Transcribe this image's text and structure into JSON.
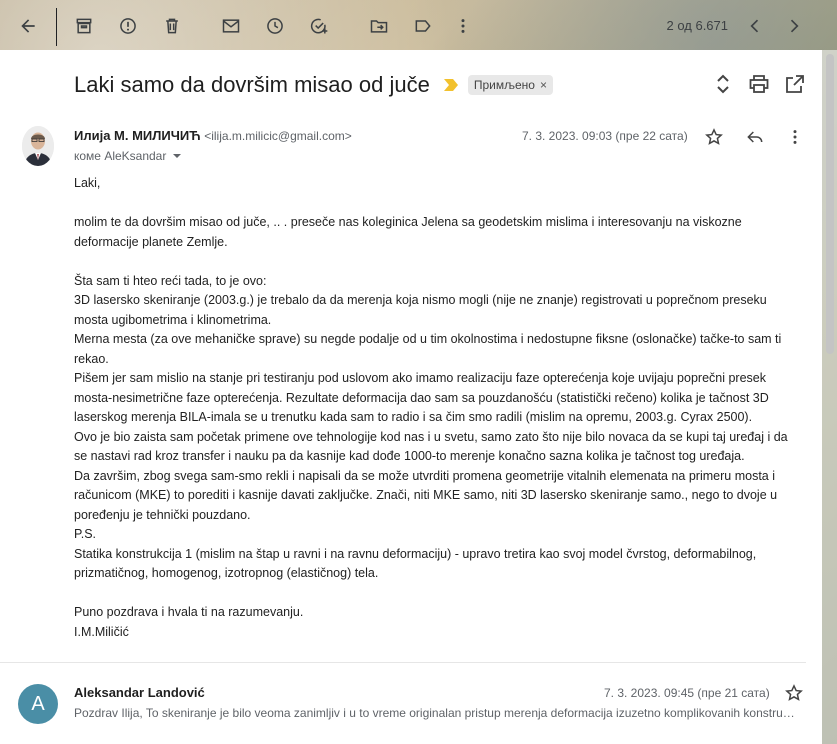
{
  "toolbar": {
    "back": "back-icon",
    "archive": "archive-icon",
    "report_spam": "report-spam-icon",
    "delete": "trash-icon",
    "mark_unread": "mail-icon",
    "snooze": "clock-icon",
    "add_task": "add-task-icon",
    "move_to": "move-to-folder-icon",
    "labels": "label-icon",
    "more": "more-vert-icon",
    "pager": "2 од 6.671"
  },
  "thread": {
    "subject": "Laki samo da dovršim misao od juče",
    "label": "Примљено",
    "label_close": "×"
  },
  "message1": {
    "sender_name": "Илија М. МИЛИЧИЋ",
    "sender_email": "<ilija.m.milicic@gmail.com>",
    "recipient": "коме AleKsandar",
    "date": "7. 3. 2023. 09:03 (пре 22 сата)",
    "body": [
      "Laki,",
      "",
      "molim te da dovršim misao od juče, .. . preseče nas koleginica Jelena sa geodetskim mislima i interesovanju na viskozne deformacije planete Zemlje.",
      "",
      "Šta sam ti hteo reći tada, to je ovo:",
      "3D lasersko skeniranje (2003.g.) je trebalo da da merenja koja nismo mogli (nije ne znanje) registrovati u poprečnom preseku mosta ugibometrima i klinometrima.",
      "Merna mesta (za ove mehaničke sprave) su negde podalje od u tim okolnostima i nedostupne fiksne (oslonačke) tačke-to sam ti rekao.",
      "Pišem jer sam mislio na stanje pri testiranju pod uslovom ako imamo realizaciju faze opterećenja koje uvijaju poprečni presek mosta-nesimetrične faze opterećenja. Rezultate deformacija dao sam sa pouzdanošću (statistički rečeno) kolika je tačnost 3D laserskog merenja BILA-imala se u trenutku kada sam to radio i sa čim smo radili (mislim na opremu, 2003.g. Cyrax 2500).",
      "Ovo je bio zaista sam početak primene ove tehnologije kod nas i u svetu, samo zato što nije bilo novaca da se kupi taj uređaj i da se nastavi rad kroz transfer i nauku pa da kasnije kad dođe 1000-to merenje konačno sazna kolika je tačnost tog uređaja.",
      "Da završim, zbog svega sam-smo rekli i napisali da se može utvrditi promena geometrije vitalnih elemenata na primeru mosta i računicom (MKE) to porediti i kasnije davati zaključke. Znači, niti MKE samo, niti 3D lasersko skeniranje samo., nego to dvoje u poređenju je tehnički pouzdano.",
      "P.S.",
      "Statika konstrukcija 1 (mislim na štap u ravni i na ravnu deformaciju) - upravo tretira kao svoj model čvrstog, deformabilnog, prizmatičnog, homogenog, izotropnog (elastičnog) tela.",
      "",
      "Puno pozdrava i hvala ti na razumevanju.",
      "I.M.Miličić"
    ]
  },
  "message2": {
    "avatar_letter": "A",
    "sender_name": "Aleksandar Landović",
    "date": "7. 3. 2023. 09:45 (пре 21 сата)",
    "snippet": "Pozdrav Ilija, To skeniranje je bilo veoma zanimljiv i u to vreme originalan pristup merenja deformacija izuzetno komplikovanih konstrukcija..."
  },
  "colors": {
    "avatar_bg": "#4a8ea6",
    "importance": "#f2c12e",
    "chip_bg": "#e8e8e8"
  }
}
